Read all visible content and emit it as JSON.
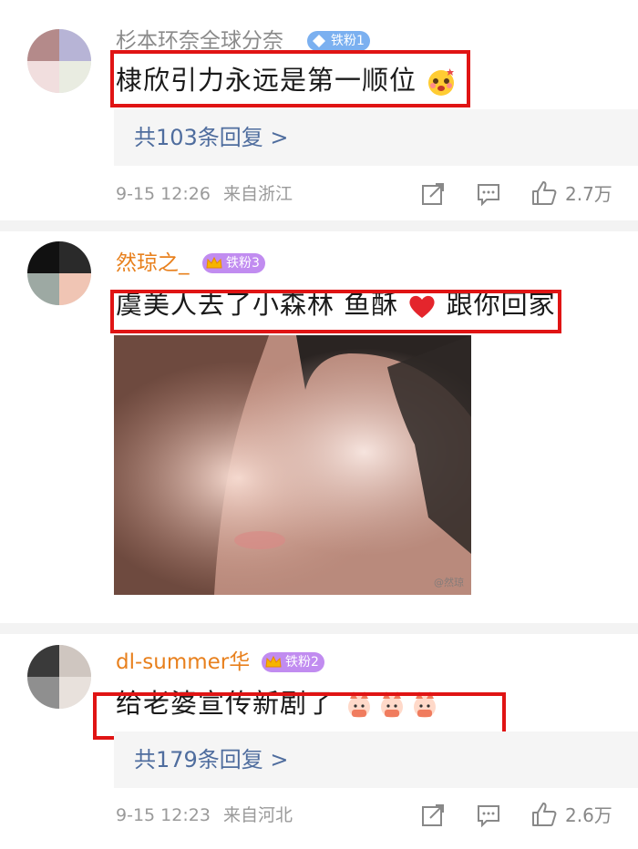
{
  "comments": [
    {
      "username": "杉本环奈全球分奈",
      "badge": "铁粉1",
      "text": "棣欣引力永远是第一顺位",
      "replies_label": "共103条回复 >",
      "time": "9-15 12:26",
      "location": "来自浙江",
      "likes": "2.7万"
    },
    {
      "username": "然琼之_",
      "badge": "铁粉3",
      "text": "虞美人去了小森林 鱼酥",
      "text_after_emoji": "跟你回家",
      "image_watermark": "@然琼"
    },
    {
      "username": "dl-summer华",
      "badge": "铁粉2",
      "text": "给老婆宣传新剧了",
      "replies_label": "共179条回复 >",
      "time": "9-15 12:23",
      "location": "来自河北",
      "likes": "2.6万"
    }
  ],
  "colors": {
    "username": "#e8801d",
    "link": "#4f6d9e",
    "highlight_box": "#e01414",
    "badge_blue": "#7bb0f0",
    "badge_purple": "#c18cf0"
  },
  "icons": [
    "share-icon",
    "comment-icon",
    "like-icon",
    "heart-icon",
    "crown-icon",
    "diamond-icon",
    "emoji-icon"
  ]
}
